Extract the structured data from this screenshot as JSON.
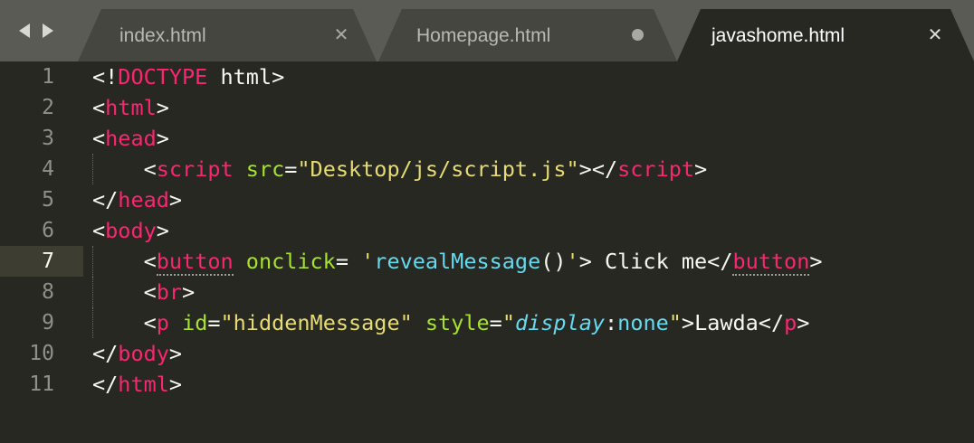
{
  "colors": {
    "background": "#272822",
    "tab_bar": "#5a5b55",
    "inactive_tab": "#45463f",
    "tag": "#f92672",
    "attribute": "#a6e22e",
    "string": "#e6db74",
    "function": "#66d9ef",
    "text": "#f8f8f2",
    "line_number": "#8f908a"
  },
  "nav": {
    "back_icon": "triangle-left-icon",
    "forward_icon": "triangle-right-icon"
  },
  "tabs": [
    {
      "label": "index.html",
      "status_icon": "close-icon",
      "status_glyph": "✕",
      "active": false
    },
    {
      "label": "Homepage.html",
      "status_icon": "unsaved-dot-icon",
      "status_glyph": "",
      "active": false
    },
    {
      "label": "javashome.html",
      "status_icon": "close-icon",
      "status_glyph": "✕",
      "active": true
    }
  ],
  "editor": {
    "current_line": 7,
    "line_numbers": [
      "1",
      "2",
      "3",
      "4",
      "5",
      "6",
      "7",
      "8",
      "9",
      "10",
      "11"
    ],
    "lines": [
      [
        [
          "p",
          "<!"
        ],
        [
          "t",
          "DOCTYPE"
        ],
        [
          "p",
          " html>"
        ]
      ],
      [
        [
          "p",
          "<"
        ],
        [
          "t",
          "html"
        ],
        [
          "p",
          ">"
        ]
      ],
      [
        [
          "p",
          "<"
        ],
        [
          "t",
          "head"
        ],
        [
          "p",
          ">"
        ]
      ],
      [
        [
          "p",
          "    <"
        ],
        [
          "t",
          "script"
        ],
        [
          "p",
          " "
        ],
        [
          "a",
          "src"
        ],
        [
          "p",
          "="
        ],
        [
          "s",
          "\"Desktop/js/script.js\""
        ],
        [
          "p",
          "></"
        ],
        [
          "t",
          "script"
        ],
        [
          "p",
          ">"
        ]
      ],
      [
        [
          "p",
          "</"
        ],
        [
          "t",
          "head"
        ],
        [
          "p",
          ">"
        ]
      ],
      [
        [
          "p",
          "<"
        ],
        [
          "t",
          "body"
        ],
        [
          "p",
          ">"
        ]
      ],
      [
        [
          "p",
          "    <"
        ],
        [
          "tu",
          "button"
        ],
        [
          "p",
          " "
        ],
        [
          "a",
          "onclick"
        ],
        [
          "p",
          "= "
        ],
        [
          "s",
          "'"
        ],
        [
          "f",
          "revealMessage"
        ],
        [
          "p",
          "()"
        ],
        [
          "s",
          "'"
        ],
        [
          "p",
          "> Click me</"
        ],
        [
          "tu",
          "button"
        ],
        [
          "p",
          ">"
        ]
      ],
      [
        [
          "p",
          "    <"
        ],
        [
          "t",
          "br"
        ],
        [
          "p",
          ">"
        ]
      ],
      [
        [
          "p",
          "    <"
        ],
        [
          "t",
          "p"
        ],
        [
          "p",
          " "
        ],
        [
          "a",
          "id"
        ],
        [
          "p",
          "="
        ],
        [
          "s",
          "\"hiddenMessage\""
        ],
        [
          "p",
          " "
        ],
        [
          "a",
          "style"
        ],
        [
          "p",
          "="
        ],
        [
          "s",
          "\""
        ],
        [
          "i",
          "display"
        ],
        [
          "p",
          ":"
        ],
        [
          "f",
          "none"
        ],
        [
          "s",
          "\""
        ],
        [
          "p",
          ">Lawda</"
        ],
        [
          "t",
          "p"
        ],
        [
          "p",
          ">"
        ]
      ],
      [
        [
          "p",
          "</"
        ],
        [
          "t",
          "body"
        ],
        [
          "p",
          ">"
        ]
      ],
      [
        [
          "p",
          "</"
        ],
        [
          "t",
          "html"
        ],
        [
          "p",
          ">"
        ]
      ]
    ]
  }
}
